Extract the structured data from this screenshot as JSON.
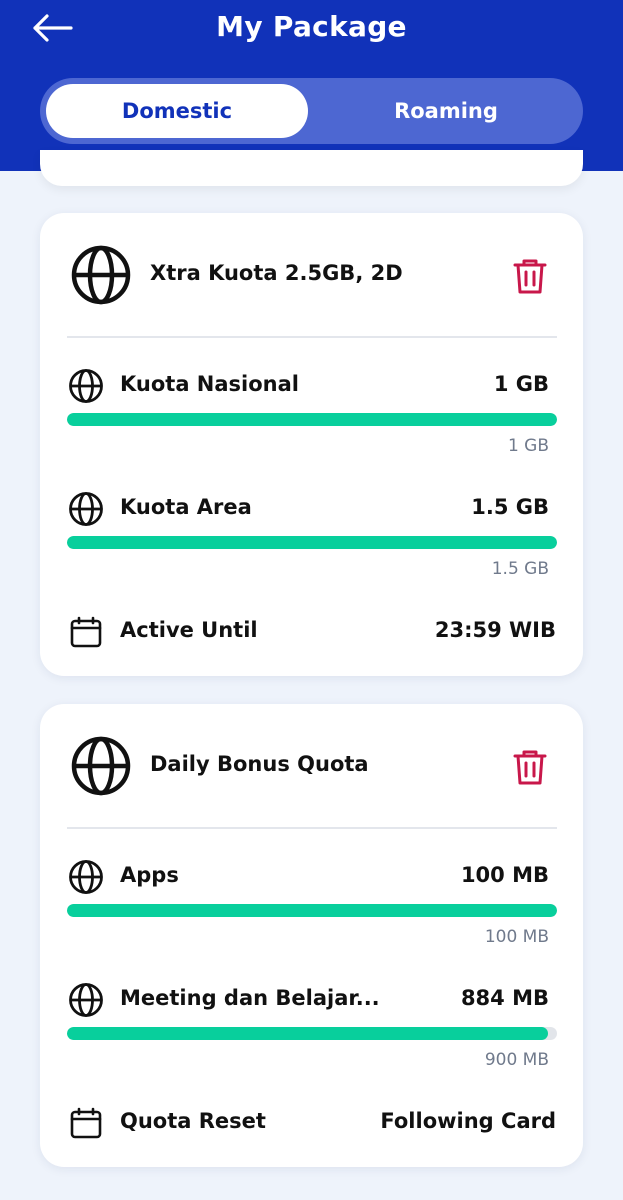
{
  "header": {
    "title": "My Package",
    "back_icon": "arrow-left-icon"
  },
  "tabs": [
    {
      "label": "Domestic",
      "active": true
    },
    {
      "label": "Roaming",
      "active": false
    }
  ],
  "colors": {
    "header_bg": "#1132b9",
    "progress": "#08cf9c",
    "trash": "#c8174a"
  },
  "packages": [
    {
      "title": "Xtra Kuota 2.5GB, 2D",
      "icon": "globe-icon",
      "action_icon": "trash-icon",
      "quotas": [
        {
          "label": "Kuota Nasional",
          "remaining": "1 GB",
          "total": "1 GB",
          "fill": 1.0
        },
        {
          "label": "Kuota Area",
          "remaining": "1.5 GB",
          "total": "1.5 GB",
          "fill": 1.0
        }
      ],
      "footer": {
        "icon": "calendar-icon",
        "label": "Active Until",
        "value": "23:59 WIB"
      }
    },
    {
      "title": "Daily Bonus Quota",
      "icon": "globe-icon",
      "action_icon": "trash-icon",
      "quotas": [
        {
          "label": "Apps",
          "remaining": "100 MB",
          "total": "100 MB",
          "fill": 1.0
        },
        {
          "label": "Meeting dan Belajar...",
          "remaining": "884 MB",
          "total": "900 MB",
          "fill": 0.982
        }
      ],
      "footer": {
        "icon": "calendar-icon",
        "label": "Quota Reset",
        "value": "Following Card"
      }
    }
  ]
}
